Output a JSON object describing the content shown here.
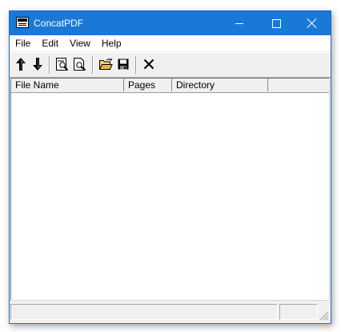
{
  "window": {
    "title": "ConcatPDF"
  },
  "menu": [
    {
      "label": "File"
    },
    {
      "label": "Edit"
    },
    {
      "label": "View"
    },
    {
      "label": "Help"
    }
  ],
  "toolbar": {
    "buttons": [
      {
        "icon": "move-up-icon"
      },
      {
        "icon": "move-down-icon"
      },
      {
        "icon": "find-icon"
      },
      {
        "icon": "preview-icon"
      },
      {
        "icon": "open-folder-icon"
      },
      {
        "icon": "save-icon"
      },
      {
        "icon": "delete-icon"
      }
    ]
  },
  "list": {
    "columns": [
      {
        "label": "File Name"
      },
      {
        "label": "Pages"
      },
      {
        "label": "Directory"
      }
    ],
    "rows": []
  },
  "status": {
    "panes": [
      "",
      ""
    ]
  },
  "colors": {
    "titlebar": "#1a78d7",
    "face": "#f0f0f0"
  }
}
